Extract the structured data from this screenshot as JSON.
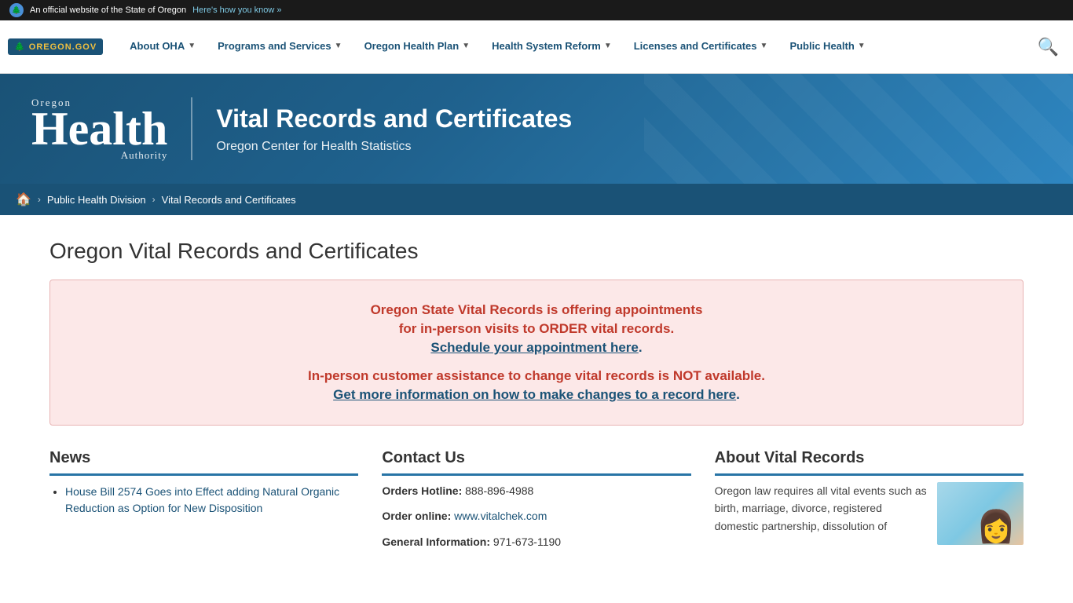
{
  "topbar": {
    "text": "An official website of the State of Oregon",
    "link_text": "Here's how you know »"
  },
  "nav": {
    "logo_text": "OREGON.GOV",
    "items": [
      {
        "label": "About OHA",
        "has_dropdown": true
      },
      {
        "label": "Programs and Services",
        "has_dropdown": true
      },
      {
        "label": "Oregon Health Plan",
        "has_dropdown": true
      },
      {
        "label": "Health System Reform",
        "has_dropdown": true
      },
      {
        "label": "Licenses and Certificates",
        "has_dropdown": true
      },
      {
        "label": "Public Health",
        "has_dropdown": true
      }
    ]
  },
  "hero": {
    "logo_oregon": "Oregon",
    "logo_health": "Health",
    "logo_authority": "Authority",
    "title": "Vital Records and Certificates",
    "subtitle": "Oregon Center for Health Statistics"
  },
  "breadcrumb": {
    "home_label": "Home",
    "items": [
      {
        "label": "Public Health Division",
        "url": "#"
      },
      {
        "label": "Vital Records and Certificates"
      }
    ]
  },
  "page": {
    "title": "Oregon Vital Records and Certificates"
  },
  "alert": {
    "line1": "Oregon State Vital Records is offering appointments",
    "line2": "for in-person visits to ORDER vital records.",
    "link_label": "Schedule your appointment here",
    "line2_end": ".",
    "line3": "In-person customer assistance to change vital records is NOT available.",
    "link2_label": "Get more information on how to make changes to a record here",
    "link2_end": "."
  },
  "news": {
    "heading": "News",
    "items": [
      {
        "label": "House Bill 2574 Goes into Effect adding Natural Organic Reduction as Option for New Disposition"
      }
    ]
  },
  "contact": {
    "heading": "Contact Us",
    "orders_hotline_label": "Orders Hotline:",
    "orders_hotline_value": "888-896-4988",
    "order_online_label": "Order online:",
    "order_online_link": "www.vitalchek.com",
    "general_info_label": "General Information:",
    "general_info_value": "971-673-1190"
  },
  "about": {
    "heading": "About Vital Records",
    "text": "Oregon law requires all vital events such as birth, marriage, divorce, registered domestic partnership, dissolution of"
  }
}
